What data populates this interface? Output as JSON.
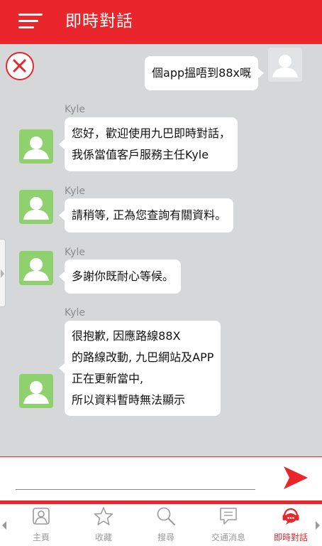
{
  "header": {
    "title": "即時對話"
  },
  "chat": {
    "messages": [
      {
        "from": "me",
        "text": "個app搵唔到88x嘅"
      },
      {
        "from": "agent",
        "sender": "Kyle",
        "text": "您好，歡迎使用九巴即時對話，\n我係當值客戶服務主任Kyle"
      },
      {
        "from": "agent",
        "sender": "Kyle",
        "text": "請稍等, 正為您查詢有關資料。"
      },
      {
        "from": "agent",
        "sender": "Kyle",
        "text": "多謝你既耐心等候。"
      },
      {
        "from": "agent",
        "sender": "Kyle",
        "text": "很抱歉, 因應路線88X\n的路線改動, 九巴網站及APP\n正在更新當中,\n所以資料暫時無法顯示"
      }
    ]
  },
  "input": {
    "value": "",
    "placeholder": ""
  },
  "tabbar": {
    "items": [
      {
        "label": "主頁",
        "icon": "home-icon",
        "active": false
      },
      {
        "label": "收藏",
        "icon": "star-icon",
        "active": false
      },
      {
        "label": "搜尋",
        "icon": "search-icon",
        "active": false
      },
      {
        "label": "交通消息",
        "icon": "message-icon",
        "active": false
      },
      {
        "label": "即時對話",
        "icon": "live-chat-icon",
        "active": true
      }
    ]
  },
  "colors": {
    "brand_red": "#e8262c",
    "chat_background": "#d6d7d9",
    "agent_avatar": "#8fd16e",
    "inactive_tab": "#9a9a9a"
  }
}
